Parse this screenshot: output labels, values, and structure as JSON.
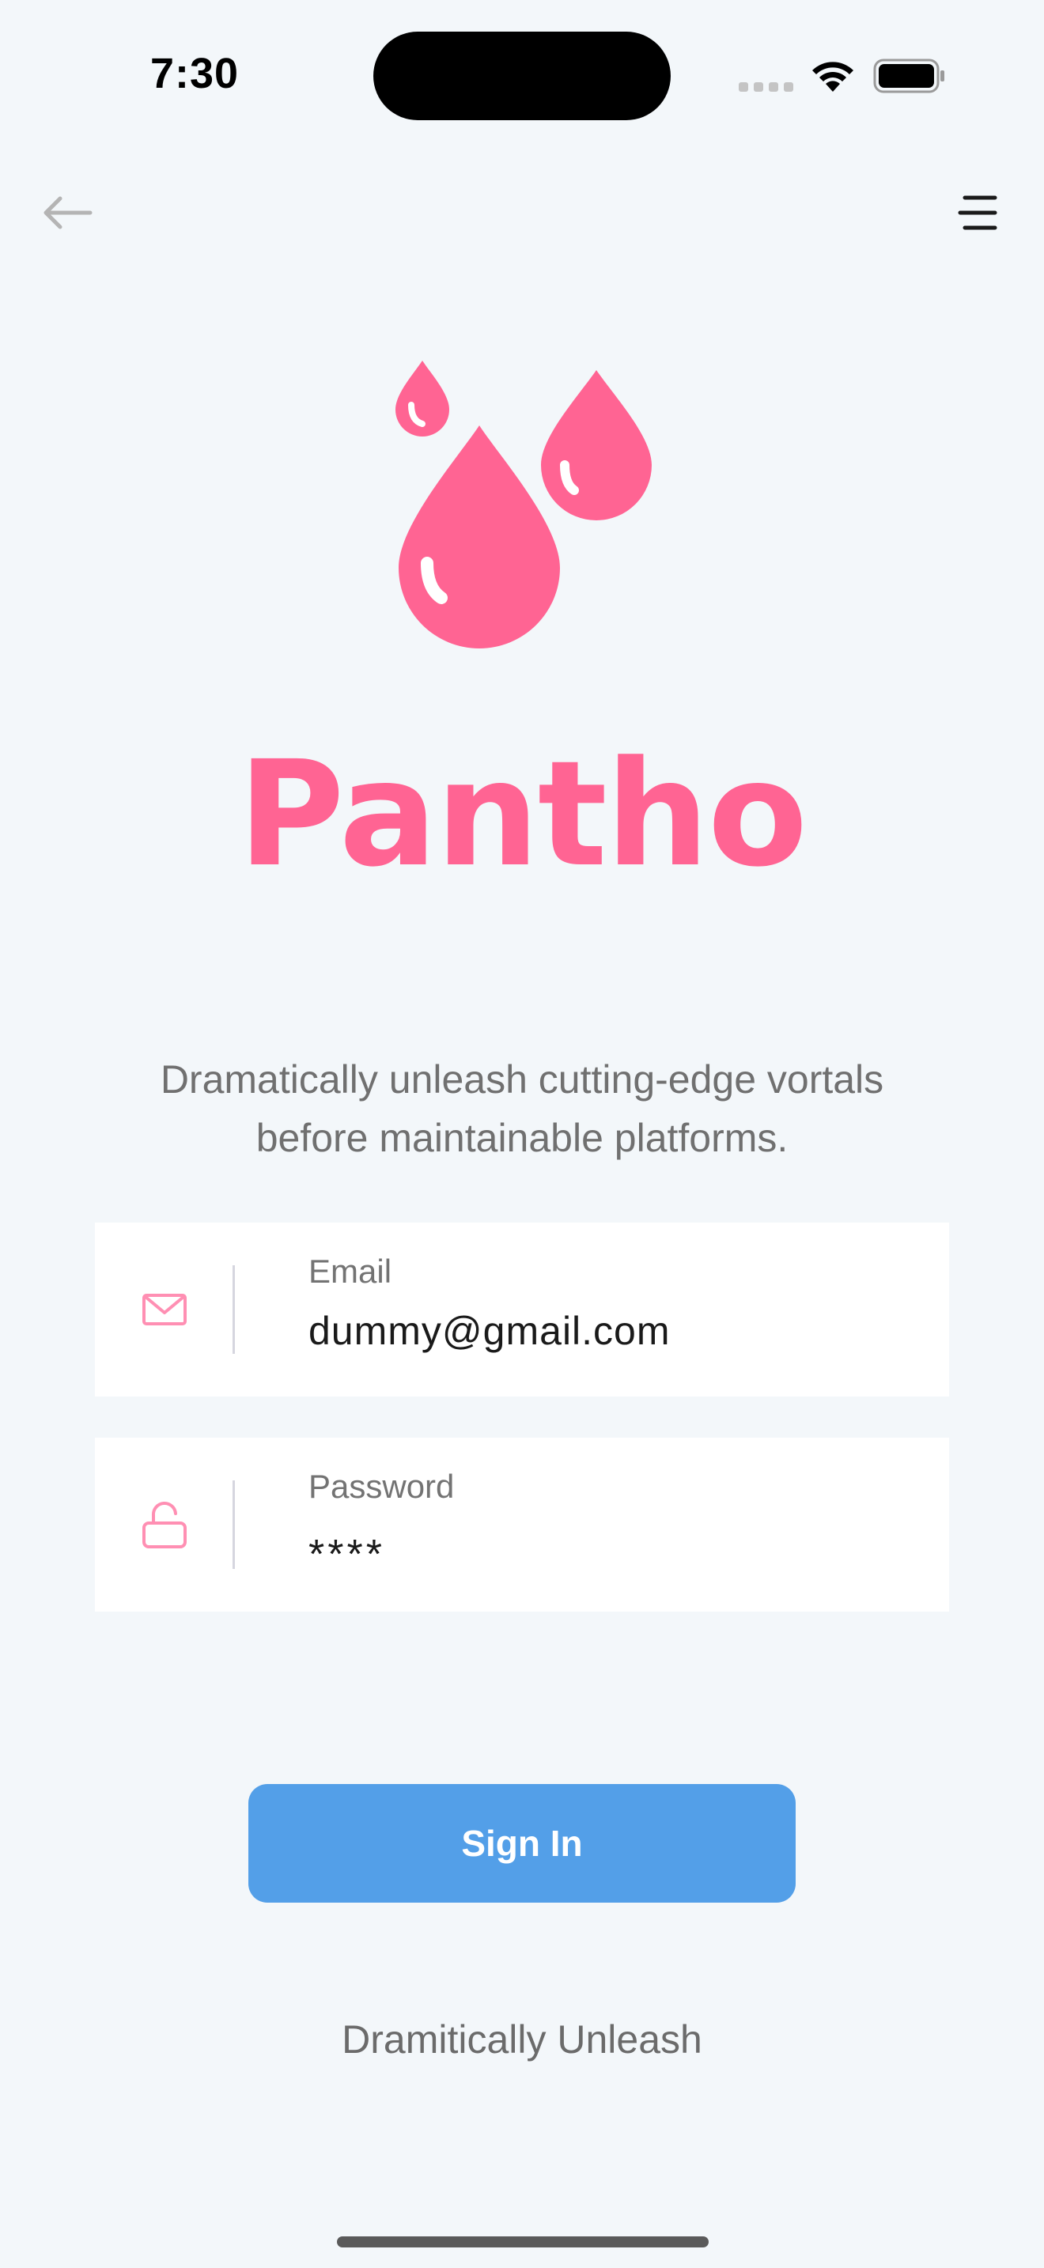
{
  "status_bar": {
    "time": "7:30"
  },
  "nav": {
    "back_icon": "arrow-left-icon",
    "menu_icon": "menu-icon"
  },
  "brand": {
    "name": "Pantho",
    "logo_icon": "water-drops-icon",
    "color": "#ff6493"
  },
  "tagline": "Dramatically unleash cutting-edge vortals before maintainable platforms.",
  "form": {
    "email": {
      "label": "Email",
      "value": "dummy@gmail.com",
      "icon": "mail-icon"
    },
    "password": {
      "label": "Password",
      "value": "****",
      "icon": "unlock-icon"
    }
  },
  "signin_button": {
    "label": "Sign In",
    "color": "#539fe8"
  },
  "footer_link": "Dramitically Unleash"
}
